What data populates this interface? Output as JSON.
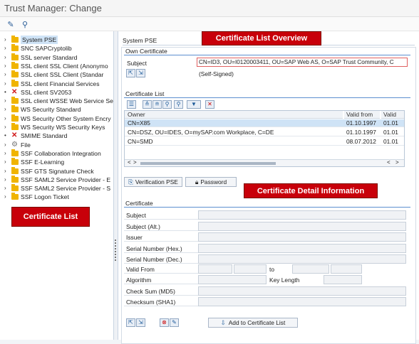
{
  "window": {
    "title": "Trust Manager: Change"
  },
  "toolbar": {
    "icons": [
      "display-change-icon",
      "binoculars-icon"
    ]
  },
  "tree": {
    "items": [
      {
        "label": "System PSE",
        "icon": "folder",
        "selected": true
      },
      {
        "label": "SNC SAPCryptolib",
        "icon": "folder"
      },
      {
        "label": "SSL server Standard",
        "icon": "folder"
      },
      {
        "label": "SSL client SSL Client (Anonymo",
        "icon": "folder"
      },
      {
        "label": "SSL client SSL Client (Standar",
        "icon": "folder"
      },
      {
        "label": "SSL client Financial Services",
        "icon": "folder"
      },
      {
        "label": "SSL client SV2053",
        "icon": "error"
      },
      {
        "label": "SSL client WSSE Web Service Se",
        "icon": "folder"
      },
      {
        "label": "WS Security Standard",
        "icon": "folder"
      },
      {
        "label": "WS Security Other System Encry",
        "icon": "folder"
      },
      {
        "label": "WS Security WS Security Keys",
        "icon": "folder"
      },
      {
        "label": "SMIME Standard",
        "icon": "error"
      },
      {
        "label": "File",
        "icon": "file"
      },
      {
        "label": "SSF Collaboration Integration",
        "icon": "folder"
      },
      {
        "label": "SSF E-Learning",
        "icon": "folder"
      },
      {
        "label": "SSF GTS Signature Check",
        "icon": "folder"
      },
      {
        "label": "SSF SAML2 Service Provider - E",
        "icon": "folder"
      },
      {
        "label": "SSF SAML2 Service Provider - S",
        "icon": "folder"
      },
      {
        "label": "SSF Logon Ticket",
        "icon": "folder"
      }
    ]
  },
  "callouts": {
    "certificate_list": "Certificate List",
    "overview": "Certificate List Overview",
    "detail": "Certificate Detail Information"
  },
  "pse": {
    "section_title": "System PSE",
    "own_cert_title": "Own Certificate",
    "subject_label": "Subject",
    "subject_value": "CN=ID3, OU=I0120003411, OU=SAP Web AS, O=SAP Trust Community, C",
    "self_signed": "(Self-Signed)"
  },
  "cert_list": {
    "title": "Certificate List",
    "columns": [
      "Owner",
      "Valid from",
      "Valid"
    ],
    "rows": [
      {
        "owner": "CN=X85",
        "valid_from": "01.10.1997",
        "valid": "01.01",
        "selected": true
      },
      {
        "owner": "CN=DSZ, OU=IDES, O=mySAP.com Workplace, C=DE",
        "valid_from": "01.10.1997",
        "valid": "01.01"
      },
      {
        "owner": "CN=SMD",
        "valid_from": "08.07.2012",
        "valid": "01.01"
      }
    ]
  },
  "buttons": {
    "verification_pse": "Verification PSE",
    "password": "Password",
    "add_to_list": "Add to Certificate List"
  },
  "certificate": {
    "title": "Certificate",
    "fields": [
      "Subject",
      "Subject (Alt.)",
      "Issuer",
      "Serial Number (Hex.)",
      "Serial Number (Dec.)"
    ],
    "valid_from": "Valid From",
    "to": "to",
    "algorithm": "Algorithm",
    "key_length": "Key Length",
    "checksum_md5": "Check Sum (MD5)",
    "checksum_sha1": "Checksum (SHA1)"
  },
  "colors": {
    "accent": "#5c8fd0",
    "callout": "#c8000a",
    "folder": "#f0b400",
    "error": "#d01818"
  }
}
